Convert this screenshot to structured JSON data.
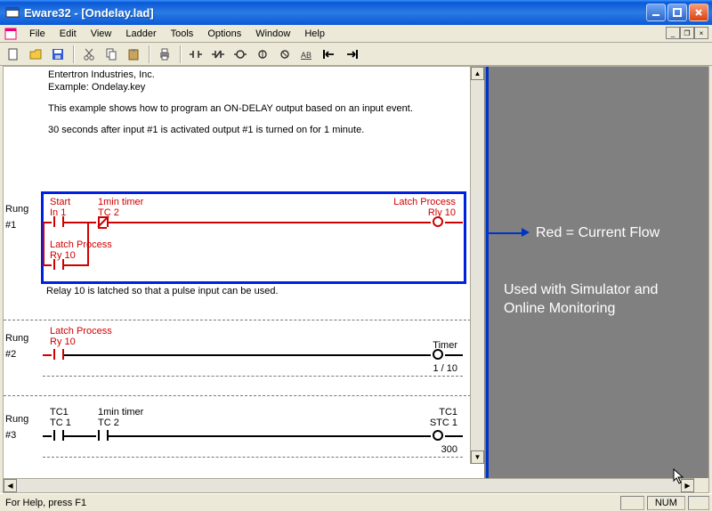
{
  "window": {
    "title": "Eware32 - [Ondelay.lad]"
  },
  "menu": {
    "items": [
      "File",
      "Edit",
      "View",
      "Ladder",
      "Tools",
      "Options",
      "Window",
      "Help"
    ]
  },
  "toolbar": {
    "buttons": [
      {
        "name": "new-icon"
      },
      {
        "name": "open-icon"
      },
      {
        "name": "save-icon"
      },
      {
        "sep": true
      },
      {
        "name": "cut-icon"
      },
      {
        "name": "copy-icon"
      },
      {
        "name": "paste-icon"
      },
      {
        "sep": true
      },
      {
        "name": "print-icon"
      },
      {
        "sep": true
      },
      {
        "name": "contact-no-icon"
      },
      {
        "name": "contact-nc-icon"
      },
      {
        "name": "coil-icon"
      },
      {
        "name": "coil-set-icon"
      },
      {
        "name": "coil-reset-icon"
      },
      {
        "name": "label-icon"
      },
      {
        "name": "branch-start-icon"
      },
      {
        "name": "branch-end-icon"
      }
    ]
  },
  "doc": {
    "header": {
      "company": "Entertron Industries, Inc.",
      "example": "Example: Ondelay.key",
      "line1": "This example shows how to program an ON-DELAY output based on an input event.",
      "line2": "30 seconds after input #1 is activated output #1 is turned on for 1 minute."
    },
    "rungs": [
      {
        "label_top": "Rung",
        "label_num": "#1",
        "elements": {
          "start_top": "Start",
          "start_bot": "In 1",
          "tmr_top": "1min timer",
          "tmr_bot": "TC 2",
          "out_top": "Latch Process",
          "out_bot": "Rly 10",
          "branch_top": "Latch Process",
          "branch_bot": "Ry 10"
        },
        "comment": "Relay 10 is latched so that a pulse input can be used."
      },
      {
        "label_top": "Rung",
        "label_num": "#2",
        "elements": {
          "in_top": "Latch Process",
          "in_bot": "Ry 10",
          "out_top": "Timer",
          "out_val": "1 / 10"
        }
      },
      {
        "label_top": "Rung",
        "label_num": "#3",
        "elements": {
          "c1_top": "TC1",
          "c1_bot": "TC 1",
          "c2_top": "1min timer",
          "c2_bot": "TC 2",
          "out_top": "TC1",
          "out_bot": "STC 1",
          "out_val": "300"
        }
      }
    ]
  },
  "annotation": {
    "line1": "Red = Current Flow",
    "line2": "Used with Simulator and Online Monitoring"
  },
  "status": {
    "help": "For Help, press F1",
    "num": "NUM"
  }
}
